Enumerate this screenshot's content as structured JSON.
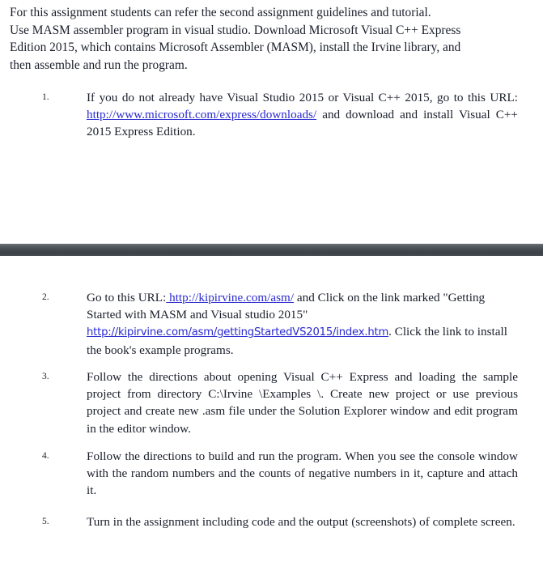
{
  "document": {
    "intro": {
      "lines": [
        "For this assignment students can refer the second assignment guidelines and tutorial.",
        "Use MASM assembler program in visual studio. Download Microsoft Visual C++ Express",
        "Edition 2015, which contains Microsoft Assembler (MASM), install the Irvine library, and",
        "then assemble and run the program."
      ]
    },
    "divider": {
      "name": "page-break-band",
      "color_top": "#6f747a",
      "color_mid": "#43484e",
      "color_bottom": "#474c52"
    },
    "items": [
      {
        "marker": "1.",
        "text_before_link": "If you do not already have Visual Studio 2015 or Visual C++ 2015, go to this URL:  ",
        "link_text": "http://www.microsoft.com/express/downloads/",
        "link_style": "serif",
        "text_after_link": "  and download and install Visual C++ 2015 Express Edition."
      },
      {
        "marker": "2.",
        "text_before_link": "Go to this URL:",
        "link_text": " http://kipirvine.com/asm/",
        "link_style": "serif",
        "text_mid": " and Click on the link marked \"Getting Started with MASM and Visual studio 2015\"",
        "link_text_2": " http://kipirvine.com/asm/gettingStartedVS2015/index.htm",
        "link_style_2": "sans",
        "text_after_link": ". Click the link to install the book's example programs."
      },
      {
        "marker": "3.",
        "text": "Follow the directions about opening Visual C++ Express and loading the sample project from directory C:\\Irvine \\Examples \\. Create new project or use previous project and create new .asm file under the Solution Explorer window and edit program in the editor window."
      },
      {
        "marker": "4.",
        "text": "Follow the directions to build and run the program. When you see the console window with the random numbers and the counts of negative numbers in it, capture and attach it."
      },
      {
        "marker": "5.",
        "text": "Turn in the assignment including code and the output (screenshots) of complete screen."
      }
    ]
  }
}
